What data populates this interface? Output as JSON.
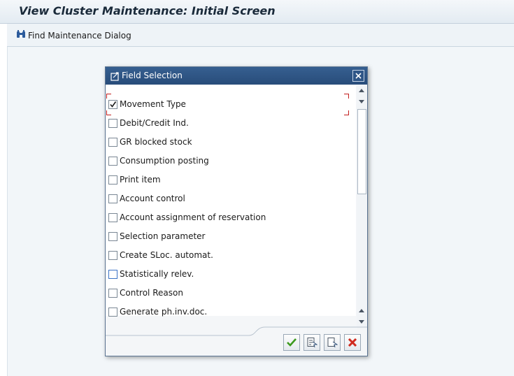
{
  "window": {
    "title": "View Cluster Maintenance: Initial Screen"
  },
  "toolbar": {
    "find_label": "Find Maintenance Dialog"
  },
  "dialog": {
    "title": "Field Selection",
    "fields": [
      {
        "label": "Movement Type",
        "checked": true
      },
      {
        "label": "Debit/Credit Ind.",
        "checked": false
      },
      {
        "label": "GR blocked stock",
        "checked": false
      },
      {
        "label": "Consumption posting",
        "checked": false
      },
      {
        "label": "Print item",
        "checked": false
      },
      {
        "label": "Account control",
        "checked": false
      },
      {
        "label": "Account assignment of reservation",
        "checked": false
      },
      {
        "label": "Selection parameter",
        "checked": false
      },
      {
        "label": "Create SLoc. automat.",
        "checked": false
      },
      {
        "label": "Statistically relev.",
        "checked": false
      },
      {
        "label": "Control Reason",
        "checked": false
      },
      {
        "label": "Generate ph.inv.doc.",
        "checked": false
      }
    ],
    "buttons": [
      "continue-icon",
      "select-all-icon",
      "deselect-all-icon",
      "cancel-icon"
    ]
  },
  "colors": {
    "dialog_header": "#365f90",
    "continue_green": "#3c9a1e",
    "cancel_red": "#d02a1e"
  }
}
